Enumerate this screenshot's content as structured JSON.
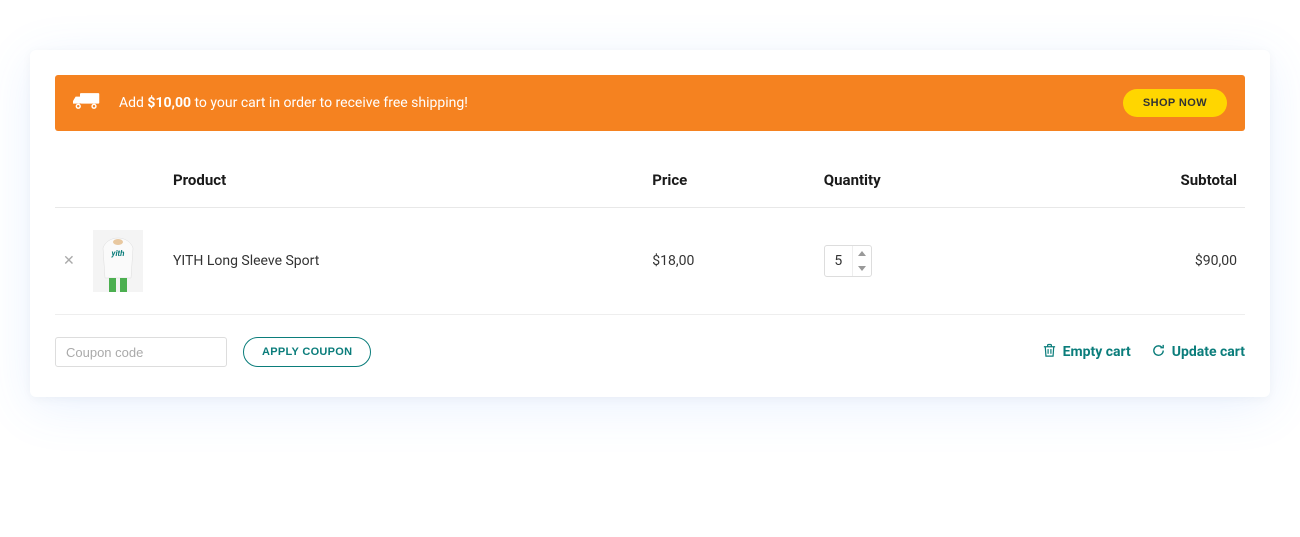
{
  "banner": {
    "prefix": "Add ",
    "amount": "$10,00",
    "suffix": " to your cart in order to receive free shipping!",
    "cta": "SHOP NOW"
  },
  "headers": {
    "product": "Product",
    "price": "Price",
    "quantity": "Quantity",
    "subtotal": "Subtotal"
  },
  "item": {
    "name": "YITH Long Sleeve Sport",
    "price": "$18,00",
    "quantity": "5",
    "subtotal": "$90,00"
  },
  "coupon": {
    "placeholder": "Coupon code",
    "apply": "APPLY COUPON"
  },
  "actions": {
    "empty": "Empty cart",
    "update": "Update cart"
  }
}
